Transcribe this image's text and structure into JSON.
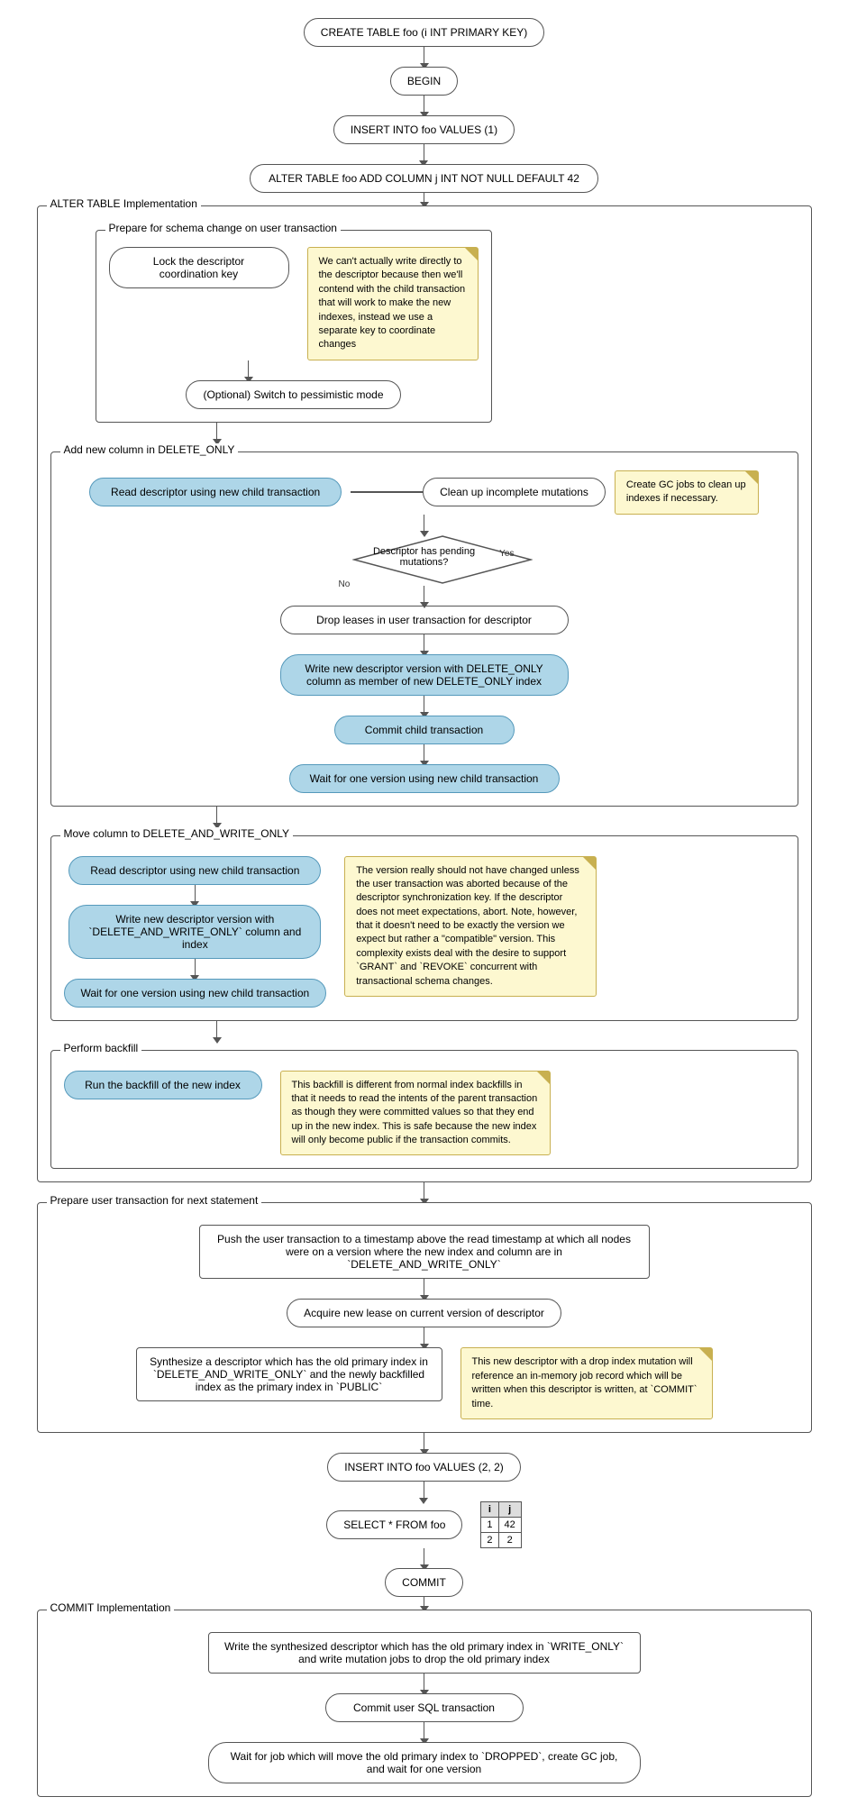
{
  "nodes": {
    "create_table": "CREATE TABLE foo (i INT PRIMARY KEY)",
    "begin": "BEGIN",
    "insert1": "INSERT INTO foo VALUES (1)",
    "alter_table": "ALTER TABLE foo ADD COLUMN j INT NOT NULL DEFAULT 42",
    "insert2": "INSERT INTO foo VALUES (2, 2)",
    "select_from_foo": "SELECT * FROM foo",
    "commit": "COMMIT"
  },
  "sections": {
    "alter_impl": "ALTER TABLE Implementation",
    "prepare_schema": "Prepare for schema change on user transaction",
    "add_col_delete_only": "Add new column in DELETE_ONLY",
    "move_col_delete_write": "Move column to DELETE_AND_WRITE_ONLY",
    "perform_backfill": "Perform backfill",
    "prepare_user_txn": "Prepare user transaction for next statement",
    "commit_impl": "COMMIT Implementation"
  },
  "steps": {
    "lock_descriptor": "Lock the descriptor coordination key",
    "optional_switch": "(Optional) Switch to pessimistic mode",
    "read_descriptor1": "Read descriptor using new child transaction",
    "descriptor_pending_q": "Descriptor has pending mutations?",
    "drop_leases": "Drop leases in user transaction for descriptor",
    "write_new_descriptor_delete_only": "Write new descriptor version with DELETE_ONLY column as member of new DELETE_ONLY index",
    "commit_child": "Commit child transaction",
    "wait_one_version1": "Wait for one version using new child transaction",
    "read_descriptor2": "Read descriptor using new child transaction",
    "write_new_descriptor_delete_write": "Write new descriptor version with `DELETE_AND_WRITE_ONLY` column and index",
    "wait_one_version2": "Wait for one version using new child transaction",
    "run_backfill": "Run the backfill of the new index",
    "push_user_txn": "Push the user transaction to a timestamp above the read timestamp at which all nodes were on a version where the new index and column are in `DELETE_AND_WRITE_ONLY`",
    "acquire_lease": "Acquire new lease on current version of descriptor",
    "synthesize_descriptor": "Synthesize a descriptor which has the old primary index in `DELETE_AND_WRITE_ONLY` and the newly backfilled index as the primary index in `PUBLIC`",
    "write_synthesized": "Write the synthesized descriptor which has the old primary index in `WRITE_ONLY` and write mutation jobs to drop the old primary index",
    "commit_user_sql": "Commit user SQL transaction",
    "wait_for_job": "Wait for job which will move the old primary index to `DROPPED`, create GC job, and wait for one version",
    "clean_up_incomplete": "Clean up incomplete mutations"
  },
  "notes": {
    "note_lock": "We can't actually write directly to the descriptor because then we'll contend with the child transaction that will work to make the new indexes, instead we use a separate key to coordinate changes",
    "note_gc_jobs": "Create GC jobs to clean up indexes if necessary.",
    "note_version": "The version really should not have changed unless the user transaction was aborted because of the descriptor synchronization key. If the descriptor does not meet expectations, abort. Note, however, that it doesn't need to be exactly the version we expect but rather a \"compatible\" version. This complexity exists deal with the desire to support `GRANT` and `REVOKE` concurrent with transactional schema changes.",
    "note_backfill": "This backfill is different from normal index backfills in that it needs to read the intents of the parent transaction as though they were committed values so that they end up in the new index. This is safe because the new index will only become public if the transaction commits.",
    "note_synthesize": "This new descriptor with a drop index mutation will reference an in-memory job record which will be written when this descriptor is written, at `COMMIT` time."
  },
  "table": {
    "headers": [
      "i",
      "j"
    ],
    "rows": [
      [
        "1",
        "42"
      ],
      [
        "2",
        "2"
      ]
    ]
  },
  "labels": {
    "yes": "Yes",
    "no": "No"
  }
}
